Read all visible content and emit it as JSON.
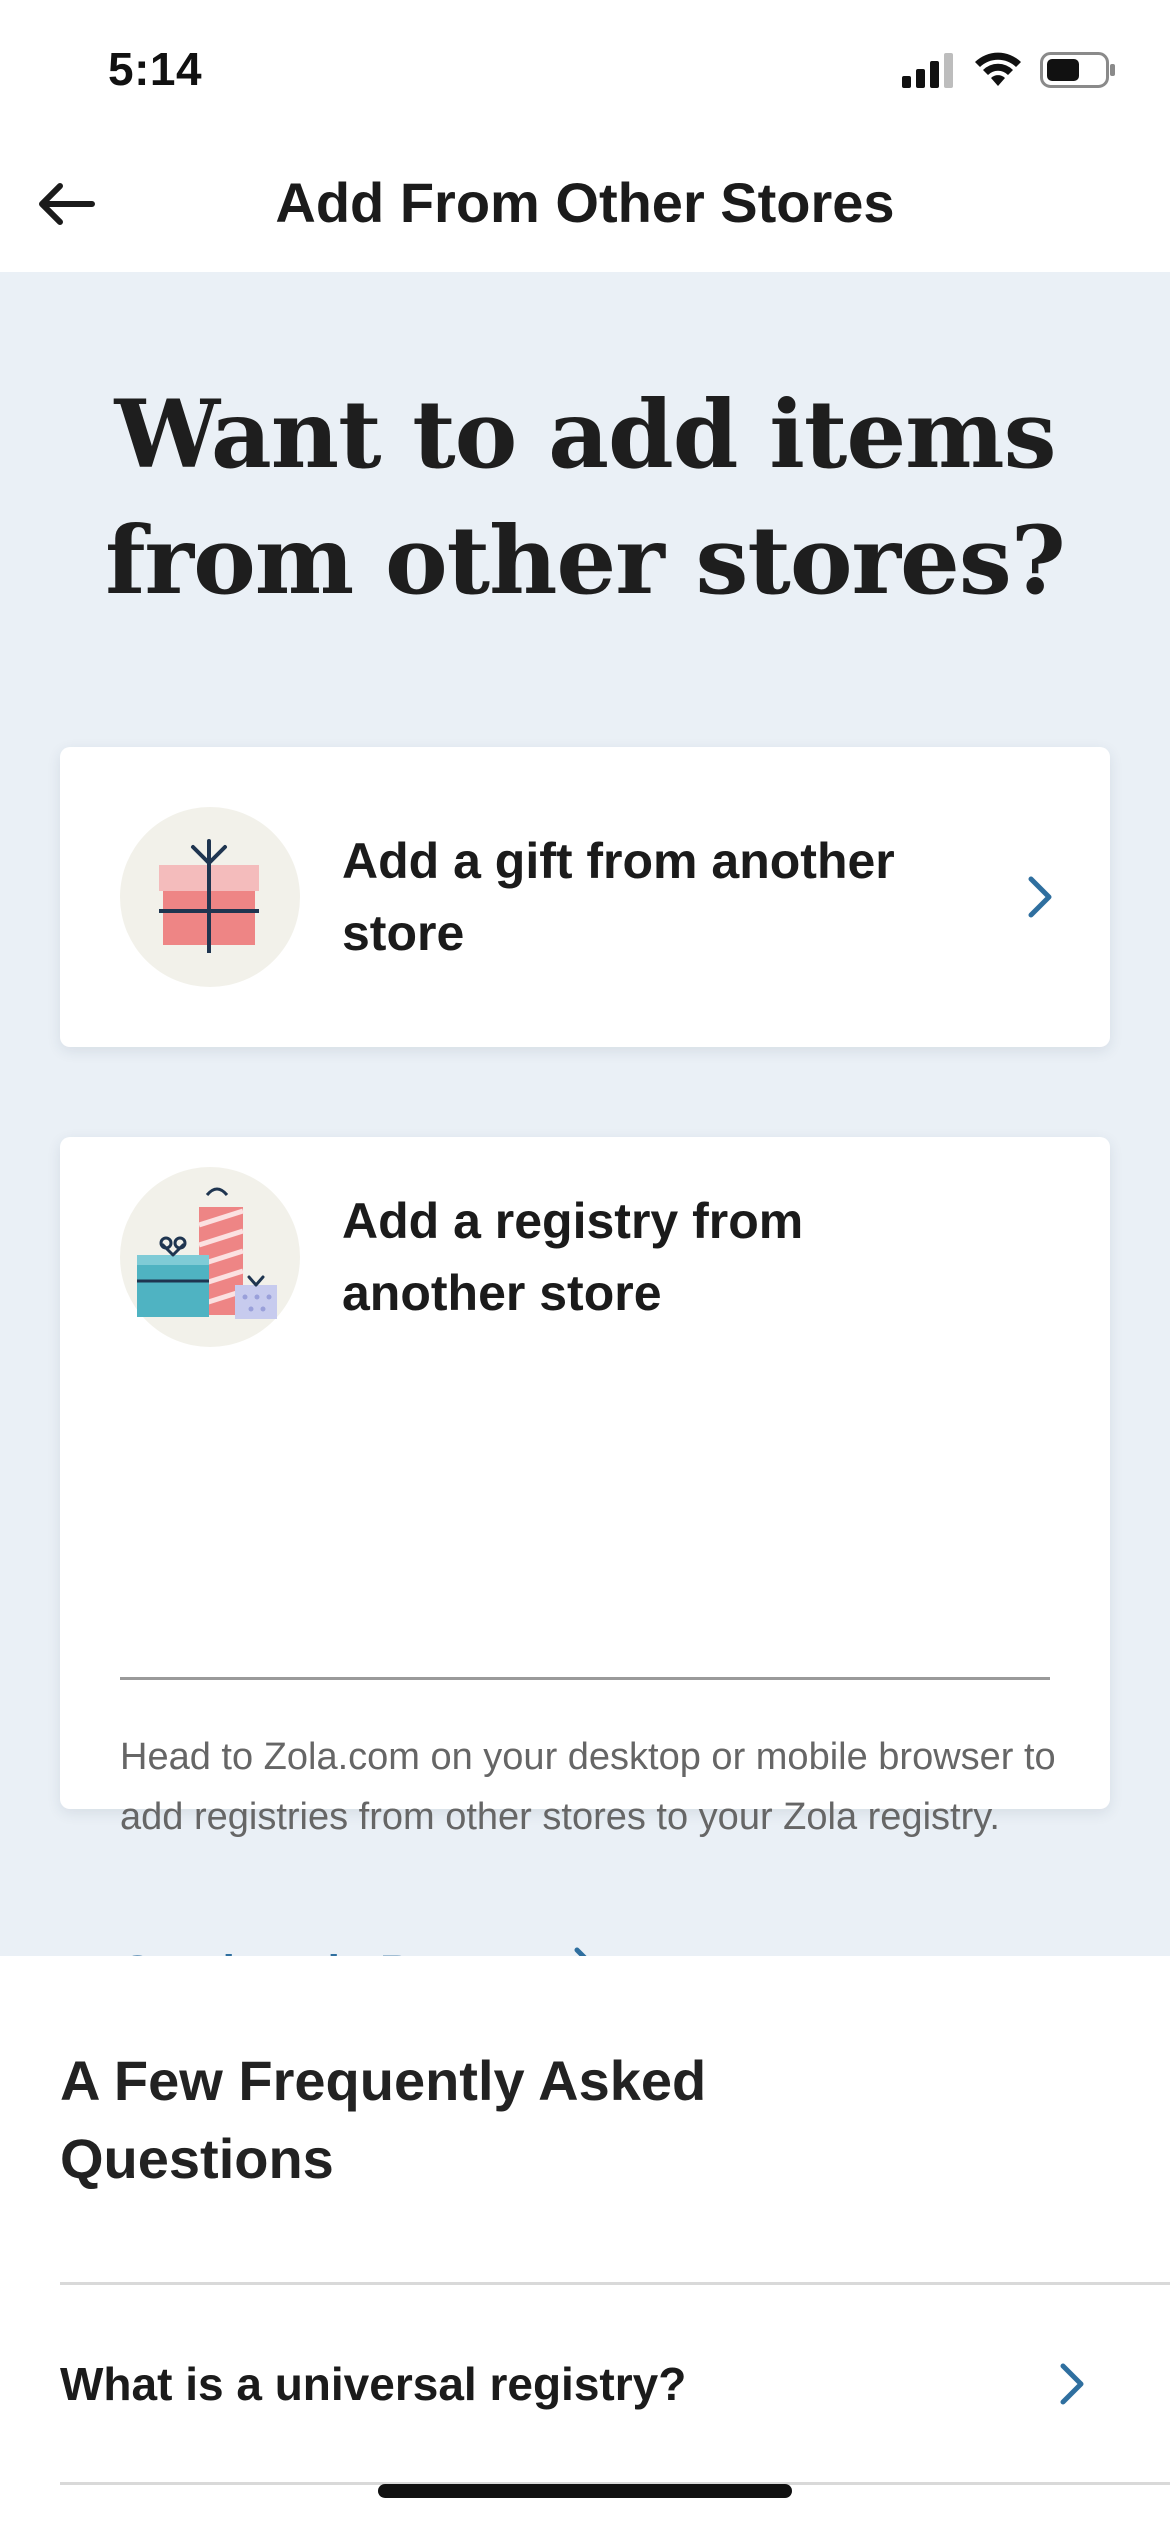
{
  "status_bar": {
    "time": "5:14",
    "icons": [
      "cellular-signal-icon",
      "wifi-icon",
      "battery-icon"
    ]
  },
  "header": {
    "back_icon": "arrow-left-icon",
    "title": "Add From Other Stores"
  },
  "hero": {
    "title": "Want to add items from other stores?"
  },
  "cards": {
    "gift": {
      "icon": "gift-box-icon",
      "label": "Add a gift from another store",
      "chevron_icon": "chevron-right-icon"
    },
    "registry": {
      "icon": "shopping-gifts-icon",
      "label": "Add a registry from another store",
      "description": "Head to Zola.com on your desktop or mobile browser to add registries from other stores to your Zola registry.",
      "link_label": "Continue in Browser"
    }
  },
  "faq": {
    "heading": "A Few Frequently Asked Questions",
    "items": [
      {
        "question": "What is a universal registry?"
      }
    ]
  },
  "colors": {
    "hero_background": "#eaf0f6",
    "link_blue": "#2f6f9f",
    "gift_pink": "#ee8585",
    "gift_teal": "#4fb3c2",
    "icon_circle": "#f2f1ea"
  }
}
